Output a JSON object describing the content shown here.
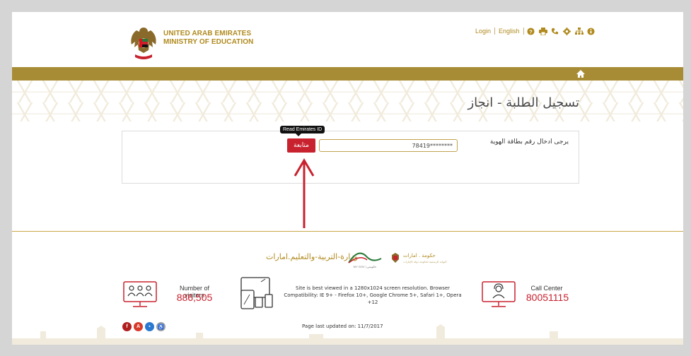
{
  "header": {
    "brand_line1": "UNITED ARAB EMIRATES",
    "brand_line2": "MINISTRY OF EDUCATION",
    "top_links": [
      "Login",
      "English"
    ],
    "top_icons": [
      "help-icon",
      "print-icon",
      "phone-icon",
      "settings-icon",
      "sitemap-icon",
      "info-icon"
    ]
  },
  "nav": {
    "home_icon": "home-icon"
  },
  "page": {
    "title": "تسجيل الطلبة - انجاز"
  },
  "form": {
    "label": "يرجى ادخال رقم بطاقة الهوية",
    "id_value": "78419********",
    "continue_label": "متابعة",
    "tooltip": "Read Emirates ID"
  },
  "footer": {
    "ministry_ar": "وزارة-التربية-والتعليم.امارات",
    "mygov_label": "MY GOV | حكومتي",
    "gov_ar": "حكومة . امارات",
    "gov_sub": "البوابة الرسمية لحكومة دولة الإمارات",
    "visitors_label": "Number of visitors",
    "visitors_count": "886,505",
    "browser_note": "Site is best viewed in a 1280x1024 screen resolution. Browser Compatibility: IE 9+ - Firefox 10+, Google Chrome 5+, Safari 1+, Opera +12",
    "call_label": "Call Center",
    "call_number": "80051115",
    "updated": "Page last updated on: 11/7/2017",
    "social_icons": [
      "flash-icon",
      "acrobat-icon",
      "windows-icon",
      "accessibility-icon"
    ]
  },
  "colors": {
    "gold": "#a88c35",
    "red": "#c8222e",
    "accent_text": "#b08a1e"
  }
}
